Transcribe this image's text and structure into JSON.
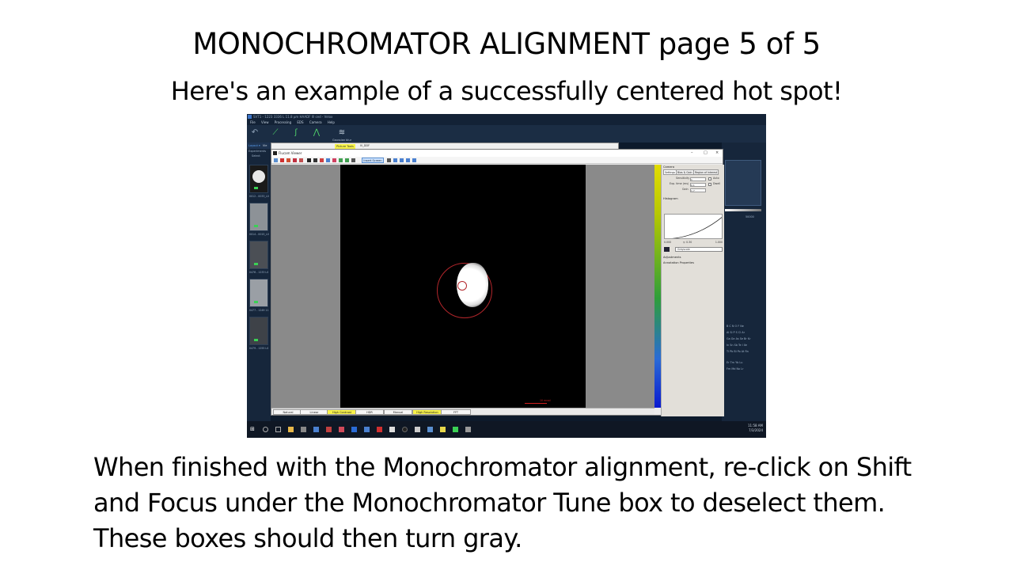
{
  "slide": {
    "title": "MONOCHROMATOR ALIGNMENT page 5 of 5",
    "subtitle": "Here's an example of a successfully centered hot spot!",
    "caption_lines": [
      "When finished with the Monochromator alignment, re-click on Shift",
      "and Focus under the Monochromator Tune box to deselect them.",
      "These boxes should then turn gray."
    ]
  },
  "screenshot": {
    "app_title": "SVT1 - 1223 3336 L 11.8 µm HAADF Ill ced - Velox",
    "menu": [
      "File",
      "View",
      "Processing",
      "EDS",
      "Camera",
      "Help"
    ],
    "toolbar_label": "Gaussian blur",
    "left_panel": {
      "tab_layout": "Layout ▾",
      "tab_other": "Vie",
      "section": "Experiments",
      "select_btn": "Select",
      "thumb_labels": [
        "0012 - 0033_L0",
        "0014 - 0015_L0",
        "0476 - 1233 L0",
        "0477 - 1249 11",
        "0479 - 1255 L0"
      ]
    },
    "background_window": {
      "picture_tools": "Picture Tools",
      "tab": "Ill_DDF"
    },
    "viewer": {
      "title": "Flucam Viewer",
      "insert_screen": "Insert Screen",
      "scale_label": "10 mrad",
      "side_panel": {
        "camera_header": "Camera",
        "tabs": [
          "Settings",
          "Bias & Gain",
          "Region of Interest"
        ],
        "sensitivity_label": "Sensitivity",
        "sensitivity_value": "1",
        "auto_label": "Auto",
        "exp_time_label": "Exp. time (ms)",
        "exp_time_value": "0.1",
        "gain_label": "Gain",
        "gain_value": "1.7",
        "dwell_label": "Dwell",
        "histogram_header": "Histogram",
        "hist_min": "0.000",
        "hist_gamma": "γ: 0.30",
        "hist_max": "1.000",
        "colormap": "Greyscale",
        "adjustments": "Adjustments",
        "annotation_props": "Annotation Properties"
      },
      "modes": [
        {
          "label": "Natural",
          "on": false
        },
        {
          "label": "Linear",
          "on": false
        },
        {
          "label": "High Contrast",
          "on": true
        },
        {
          "label": "HDR",
          "on": false
        },
        {
          "label": "Manual",
          "on": false
        },
        {
          "label": "High Resolution",
          "on": true
        },
        {
          "label": "FFT",
          "on": false
        }
      ]
    },
    "right_panel": {
      "value": "50000",
      "periodic_rows": [
        "B C N O F Ne",
        "Al Si P S Cl Ar",
        "Ga Ge As Se Br Kr",
        "In Sn Sb Te I Xe",
        "Tl Pb Bi Po At Rn"
      ],
      "extra_rows": [
        "Er Tm Yb Lu",
        "Fm Md No Lr"
      ]
    },
    "clock": {
      "time": "11:58 AM",
      "date": "7/3/2024"
    },
    "colors": {
      "accent": "#3b73c7",
      "active_mode": "#f7f24a",
      "scale": "#d02020"
    }
  }
}
